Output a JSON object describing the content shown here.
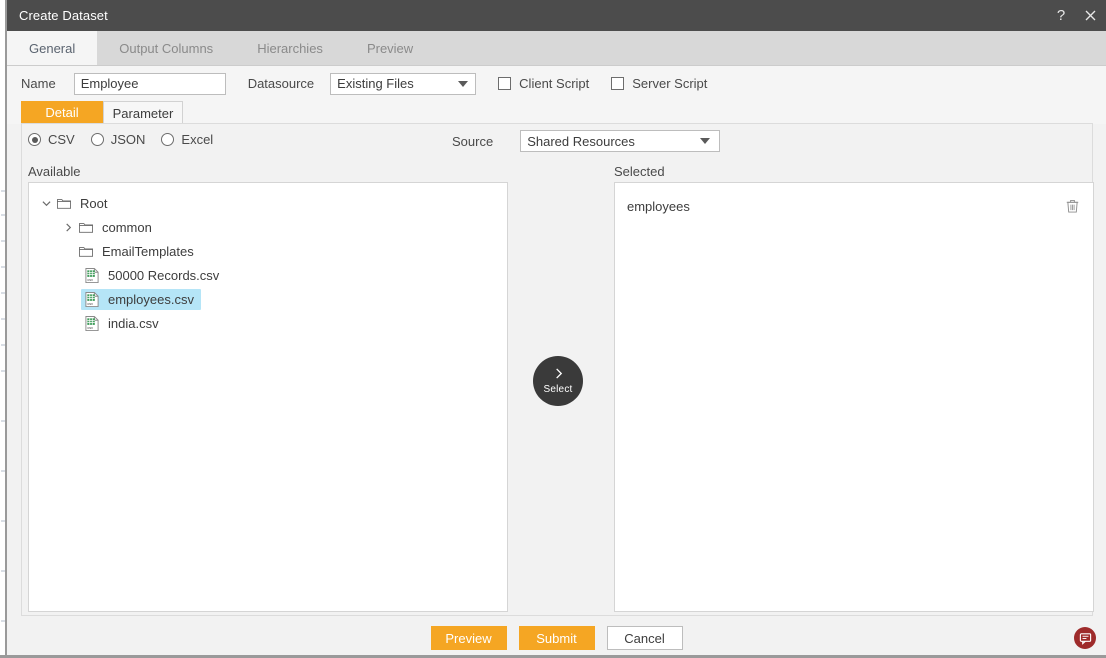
{
  "window": {
    "title": "Create Dataset",
    "help_icon": "question-mark-icon",
    "close_icon": "close-icon",
    "accent_color": "#f5a623",
    "titlebar_color": "#4c4c4c"
  },
  "tabs": [
    {
      "label": "General",
      "active": true
    },
    {
      "label": "Output Columns",
      "active": false
    },
    {
      "label": "Hierarchies",
      "active": false
    },
    {
      "label": "Preview",
      "active": false
    }
  ],
  "form": {
    "name_label": "Name",
    "name_value": "Employee",
    "name_placeholder": "",
    "datasource_label": "Datasource",
    "datasource_value": "Existing Files",
    "client_script_label": "Client Script",
    "client_script_checked": false,
    "server_script_label": "Server Script",
    "server_script_checked": false
  },
  "subtabs": [
    {
      "label": "Detail",
      "active": true
    },
    {
      "label": "Parameter",
      "active": false
    }
  ],
  "filetype": {
    "options": [
      {
        "label": "CSV",
        "selected": true
      },
      {
        "label": "JSON",
        "selected": false
      },
      {
        "label": "Excel",
        "selected": false
      }
    ]
  },
  "source": {
    "label": "Source",
    "value": "Shared Resources"
  },
  "available": {
    "header": "Available",
    "tree": [
      {
        "label": "Root",
        "type": "folder",
        "depth": 0,
        "twisty": "expanded",
        "selected": false
      },
      {
        "label": "common",
        "type": "folder",
        "depth": 1,
        "twisty": "collapsed",
        "selected": false
      },
      {
        "label": "EmailTemplates",
        "type": "folder",
        "depth": 1,
        "twisty": "none",
        "selected": false
      },
      {
        "label": "50000 Records.csv",
        "type": "csv",
        "depth": 2,
        "twisty": "none",
        "selected": false
      },
      {
        "label": "employees.csv",
        "type": "csv",
        "depth": 2,
        "twisty": "none",
        "selected": true
      },
      {
        "label": "india.csv",
        "type": "csv",
        "depth": 2,
        "twisty": "none",
        "selected": false
      }
    ]
  },
  "select_button": {
    "label": "Select",
    "icon": "chevron-right-icon"
  },
  "selected": {
    "header": "Selected",
    "items": [
      {
        "name": "employees",
        "delete_icon": "trash-icon"
      }
    ]
  },
  "footer": {
    "buttons": [
      {
        "label": "Preview",
        "style": "primary"
      },
      {
        "label": "Submit",
        "style": "primary"
      },
      {
        "label": "Cancel",
        "style": "plain"
      }
    ]
  },
  "feedback": {
    "icon": "chat-bubble-icon",
    "color": "#9e2b2b"
  }
}
